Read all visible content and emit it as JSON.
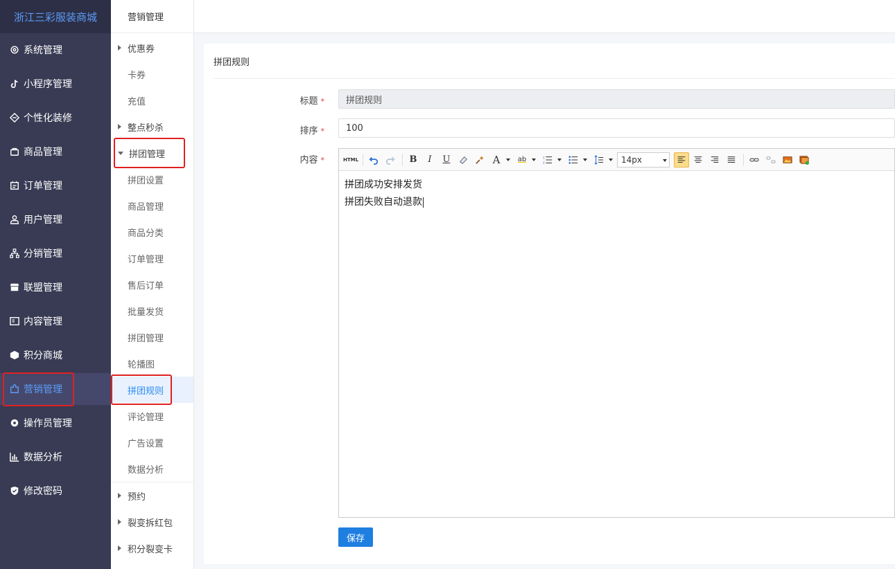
{
  "brand": "浙江三彩服装商城",
  "sidebar": {
    "items": [
      {
        "label": "系统管理",
        "icon": "gear-outline-icon"
      },
      {
        "label": "小程序管理",
        "icon": "tiktok-icon"
      },
      {
        "label": "个性化装修",
        "icon": "layers-icon"
      },
      {
        "label": "商品管理",
        "icon": "bag-icon"
      },
      {
        "label": "订单管理",
        "icon": "calendar-icon"
      },
      {
        "label": "用户管理",
        "icon": "user-icon"
      },
      {
        "label": "分销管理",
        "icon": "sitemap-icon"
      },
      {
        "label": "联盟管理",
        "icon": "store-icon"
      },
      {
        "label": "内容管理",
        "icon": "content-icon"
      },
      {
        "label": "积分商城",
        "icon": "cube-icon"
      },
      {
        "label": "营销管理",
        "icon": "puzzle-icon"
      },
      {
        "label": "操作员管理",
        "icon": "gear-solid-icon"
      },
      {
        "label": "数据分析",
        "icon": "bar-chart-icon"
      },
      {
        "label": "修改密码",
        "icon": "shield-check-icon"
      }
    ]
  },
  "submenu": {
    "header": "营销管理",
    "items": [
      {
        "label": "优惠券"
      },
      {
        "label": "卡券"
      },
      {
        "label": "充值"
      },
      {
        "label": "整点秒杀"
      },
      {
        "label": "拼团管理"
      },
      {
        "label": "拼团设置"
      },
      {
        "label": "商品管理"
      },
      {
        "label": "商品分类"
      },
      {
        "label": "订单管理"
      },
      {
        "label": "售后订单"
      },
      {
        "label": "批量发货"
      },
      {
        "label": "拼团管理"
      },
      {
        "label": "轮播图"
      },
      {
        "label": "拼团规则"
      },
      {
        "label": "评论管理"
      },
      {
        "label": "广告设置"
      },
      {
        "label": "数据分析"
      },
      {
        "label": "预约"
      },
      {
        "label": "裂变拆红包"
      },
      {
        "label": "积分裂变卡"
      }
    ]
  },
  "panel": {
    "title": "拼团规则",
    "fields": {
      "title_label": "标题",
      "title_value": "拼团规则",
      "sort_label": "排序",
      "sort_value": "100",
      "content_label": "内容",
      "required_mark": "*"
    },
    "editor": {
      "html_button": "HTML",
      "bold": "B",
      "italic": "I",
      "underline": "U",
      "font_color": "A",
      "highlight": "ab",
      "font_size": "14px",
      "lines": [
        "拼团成功安排发货",
        "拼团失败自动退款"
      ]
    },
    "save_label": "保存"
  }
}
